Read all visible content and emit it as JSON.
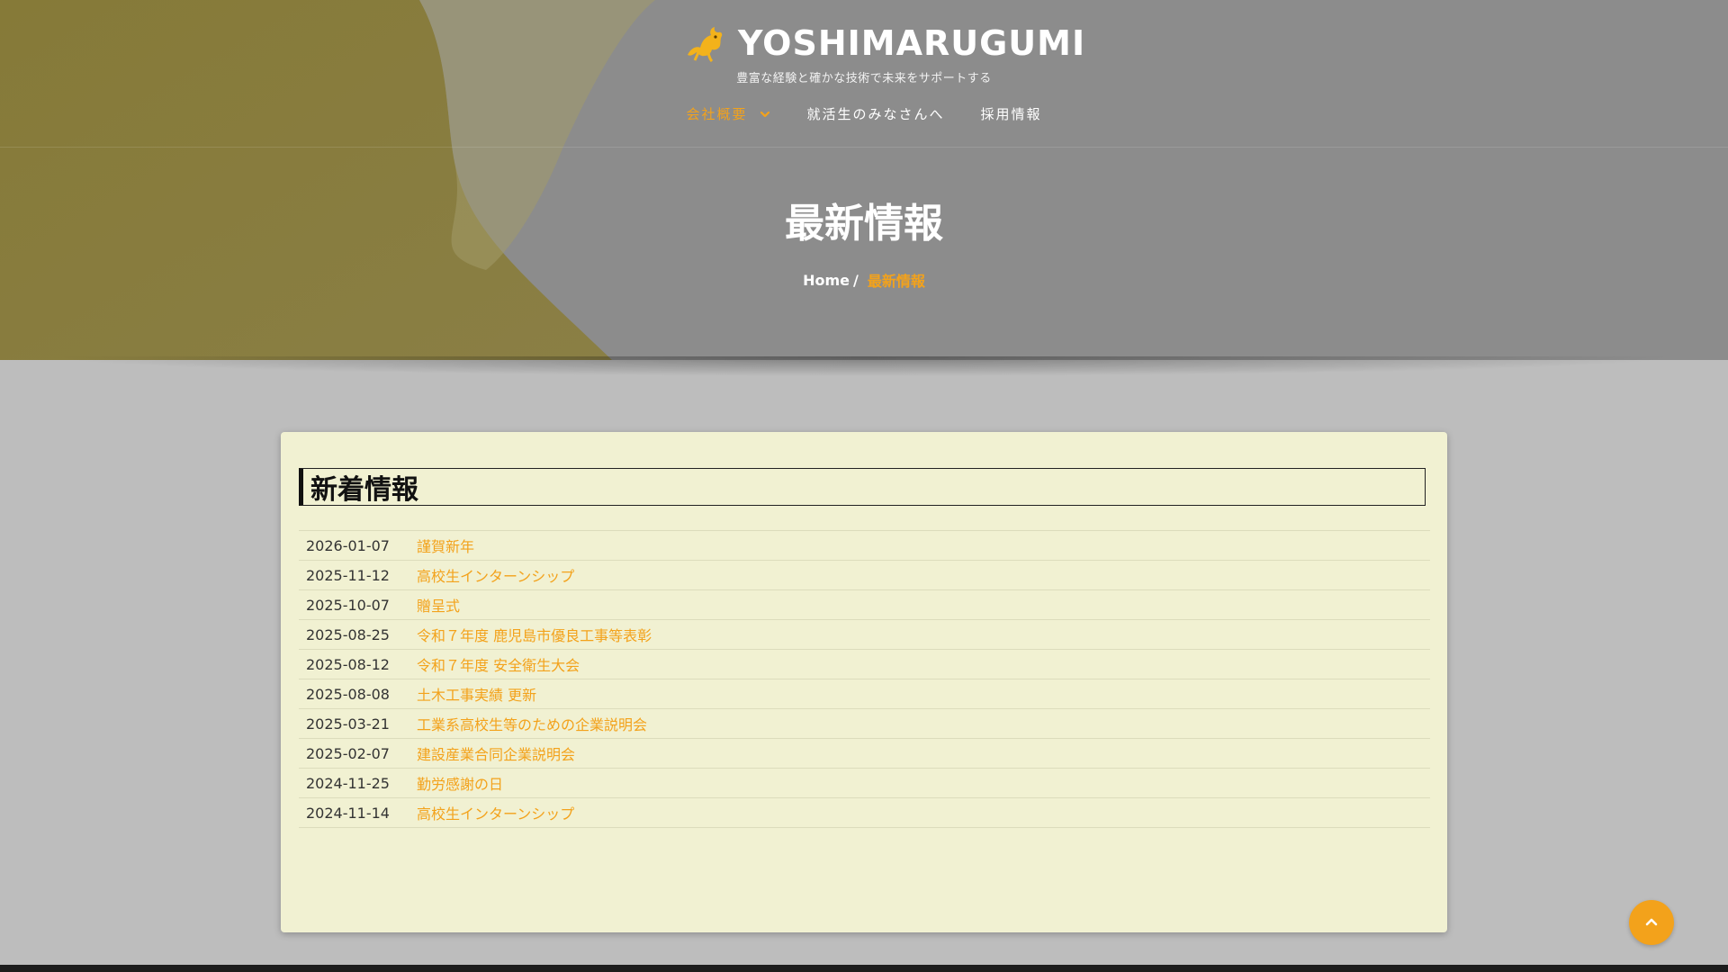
{
  "brand": {
    "name": "YOSHIMARUGUMI",
    "tagline": "豊富な経験と確かな技術で未来をサポートする",
    "logo_icon": "bull-icon"
  },
  "nav": {
    "items": [
      {
        "label": "会社概要",
        "active": true,
        "has_dropdown": true
      },
      {
        "label": "就活生のみなさんへ",
        "active": false
      },
      {
        "label": "採用情報",
        "active": false
      }
    ]
  },
  "page": {
    "title": "最新情報"
  },
  "breadcrumb": {
    "home": "Home",
    "separator": "/",
    "current": "最新情報"
  },
  "news": {
    "heading": "新着情報",
    "items": [
      {
        "date": "2026-01-07",
        "title": "謹賀新年"
      },
      {
        "date": "2025-11-12",
        "title": "高校生インターンシップ"
      },
      {
        "date": "2025-10-07",
        "title": "贈呈式"
      },
      {
        "date": "2025-08-25",
        "title": "令和７年度 鹿児島市優良工事等表彰"
      },
      {
        "date": "2025-08-12",
        "title": "令和７年度 安全衛生大会"
      },
      {
        "date": "2025-08-08",
        "title": "土木工事実績 更新"
      },
      {
        "date": "2025-03-21",
        "title": "工業系高校生等のための企業説明会"
      },
      {
        "date": "2025-02-07",
        "title": "建設産業合同企業説明会"
      },
      {
        "date": "2024-11-25",
        "title": "勤労感謝の日"
      },
      {
        "date": "2024-11-14",
        "title": "高校生インターンシップ"
      }
    ]
  },
  "colors": {
    "accent": "#f3a21b",
    "hero_gray": "#8c8c8c",
    "hero_olive": "#857a3c",
    "card_bg": "#f1f1d2",
    "page_bg": "#bdbdbd"
  },
  "back_to_top": {
    "icon": "chevron-up-icon"
  }
}
